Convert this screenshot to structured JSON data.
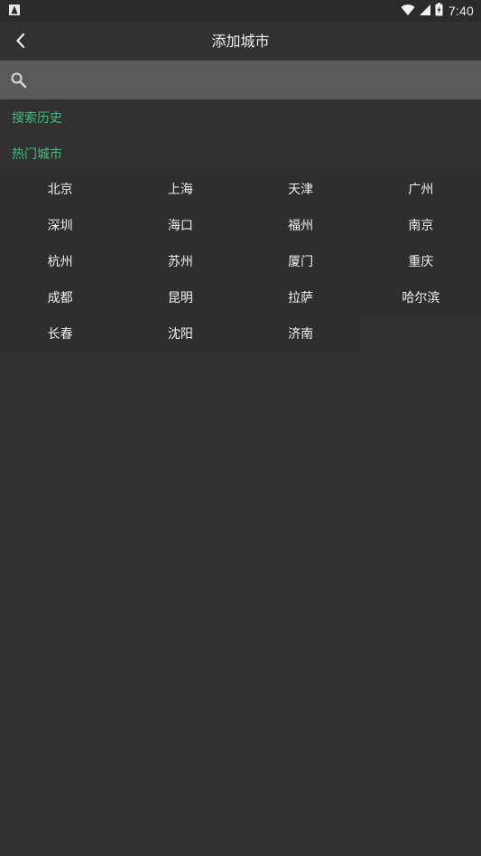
{
  "status_bar": {
    "time": "7:40",
    "icons": [
      "app-notification-icon",
      "wifi-icon",
      "cell-signal-icon",
      "battery-icon"
    ]
  },
  "header": {
    "back_icon": "chevron-left-icon",
    "title": "添加城市"
  },
  "search": {
    "icon": "search-icon",
    "value": "",
    "placeholder": ""
  },
  "sections": {
    "history": "搜索历史",
    "hot": "热门城市"
  },
  "hot_cities": [
    [
      "北京",
      "上海",
      "天津",
      "广州"
    ],
    [
      "深圳",
      "海口",
      "福州",
      "南京"
    ],
    [
      "杭州",
      "苏州",
      "厦门",
      "重庆"
    ],
    [
      "成都",
      "昆明",
      "拉萨",
      "哈尔滨"
    ],
    [
      "长春",
      "沈阳",
      "济南"
    ]
  ],
  "colors": {
    "background": "#313131",
    "search_background": "#5a5a5a",
    "accent": "#3cbf7a",
    "text": "#f2f2f2"
  }
}
